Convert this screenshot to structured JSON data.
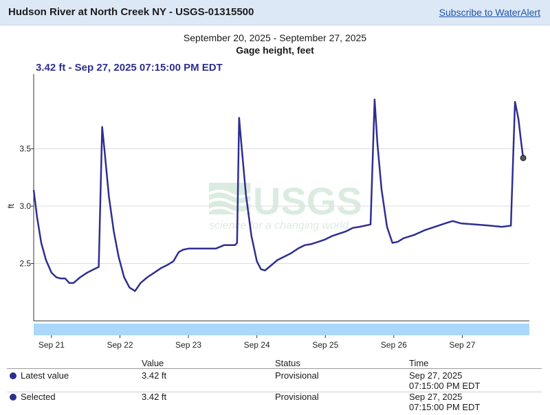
{
  "header": {
    "title": "Hudson River at North Creek NY - USGS-01315500",
    "subscribe_label": "Subscribe to WaterAlert"
  },
  "chart_header": {
    "date_range": "September 20, 2025 - September 27, 2025",
    "parameter": "Gage height, feet",
    "tooltip": "3.42 ft - Sep 27, 2025 07:15:00 PM EDT"
  },
  "watermark": {
    "logo_text": "USGS",
    "tagline": "science for a changing world"
  },
  "colors": {
    "series": "#2e2e91",
    "brush": "#a9d8fb",
    "header_bg": "#dde8f6"
  },
  "chart_data": {
    "type": "line",
    "title": "Gage height, feet",
    "ylabel": "ft",
    "xlabel": "",
    "ylim": [
      2.0,
      4.15
    ],
    "y_ticks": [
      2.5,
      3.0,
      3.5
    ],
    "y_tick_labels": [
      "2.5",
      "3.0",
      "3.5"
    ],
    "x_range": [
      20.74,
      27.98
    ],
    "x_tick_values": [
      21,
      22,
      23,
      24,
      25,
      26,
      27
    ],
    "x_tick_labels": [
      "Sep 21",
      "Sep 22",
      "Sep 23",
      "Sep 24",
      "Sep 25",
      "Sep 26",
      "Sep 27"
    ],
    "grid": true,
    "series": [
      {
        "values_x_unit": "day of September 2025",
        "points": [
          [
            20.74,
            3.14
          ],
          [
            20.79,
            2.9
          ],
          [
            20.85,
            2.68
          ],
          [
            20.92,
            2.53
          ],
          [
            21.0,
            2.42
          ],
          [
            21.07,
            2.38
          ],
          [
            21.13,
            2.37
          ],
          [
            21.2,
            2.37
          ],
          [
            21.26,
            2.33
          ],
          [
            21.32,
            2.33
          ],
          [
            21.42,
            2.38
          ],
          [
            21.52,
            2.42
          ],
          [
            21.62,
            2.45
          ],
          [
            21.69,
            2.47
          ],
          [
            21.74,
            3.69
          ],
          [
            21.78,
            3.45
          ],
          [
            21.84,
            3.08
          ],
          [
            21.91,
            2.78
          ],
          [
            21.98,
            2.56
          ],
          [
            22.06,
            2.38
          ],
          [
            22.14,
            2.29
          ],
          [
            22.22,
            2.26
          ],
          [
            22.3,
            2.33
          ],
          [
            22.4,
            2.38
          ],
          [
            22.5,
            2.42
          ],
          [
            22.6,
            2.46
          ],
          [
            22.7,
            2.49
          ],
          [
            22.78,
            2.52
          ],
          [
            22.86,
            2.6
          ],
          [
            22.92,
            2.62
          ],
          [
            23.0,
            2.63
          ],
          [
            23.2,
            2.63
          ],
          [
            23.4,
            2.63
          ],
          [
            23.52,
            2.66
          ],
          [
            23.68,
            2.66
          ],
          [
            23.71,
            2.68
          ],
          [
            23.74,
            3.77
          ],
          [
            23.78,
            3.5
          ],
          [
            23.84,
            3.1
          ],
          [
            23.92,
            2.74
          ],
          [
            24.0,
            2.52
          ],
          [
            24.06,
            2.45
          ],
          [
            24.12,
            2.44
          ],
          [
            24.2,
            2.48
          ],
          [
            24.3,
            2.53
          ],
          [
            24.4,
            2.56
          ],
          [
            24.5,
            2.59
          ],
          [
            24.6,
            2.63
          ],
          [
            24.7,
            2.66
          ],
          [
            24.8,
            2.67
          ],
          [
            24.9,
            2.69
          ],
          [
            25.0,
            2.71
          ],
          [
            25.1,
            2.74
          ],
          [
            25.2,
            2.76
          ],
          [
            25.3,
            2.78
          ],
          [
            25.4,
            2.81
          ],
          [
            25.5,
            2.82
          ],
          [
            25.66,
            2.84
          ],
          [
            25.72,
            3.93
          ],
          [
            25.76,
            3.55
          ],
          [
            25.82,
            3.15
          ],
          [
            25.9,
            2.82
          ],
          [
            25.98,
            2.68
          ],
          [
            26.06,
            2.69
          ],
          [
            26.14,
            2.72
          ],
          [
            26.3,
            2.75
          ],
          [
            26.45,
            2.79
          ],
          [
            26.6,
            2.82
          ],
          [
            26.75,
            2.85
          ],
          [
            26.86,
            2.87
          ],
          [
            26.98,
            2.85
          ],
          [
            27.2,
            2.84
          ],
          [
            27.4,
            2.83
          ],
          [
            27.58,
            2.82
          ],
          [
            27.71,
            2.83
          ],
          [
            27.77,
            3.91
          ],
          [
            27.82,
            3.76
          ],
          [
            27.86,
            3.56
          ],
          [
            27.89,
            3.42
          ]
        ],
        "latest_point": [
          27.89,
          3.42
        ]
      }
    ]
  },
  "table": {
    "headers": [
      "Value",
      "Status",
      "Time"
    ],
    "rows": [
      {
        "label": "Latest value",
        "value": "3.42 ft",
        "status": "Provisional",
        "time_date": "Sep 27, 2025",
        "time_clock": "07:15:00 PM EDT"
      },
      {
        "label": "Selected",
        "value": "3.42 ft",
        "status": "Provisional",
        "time_date": "Sep 27, 2025",
        "time_clock": "07:15:00 PM EDT"
      }
    ]
  }
}
